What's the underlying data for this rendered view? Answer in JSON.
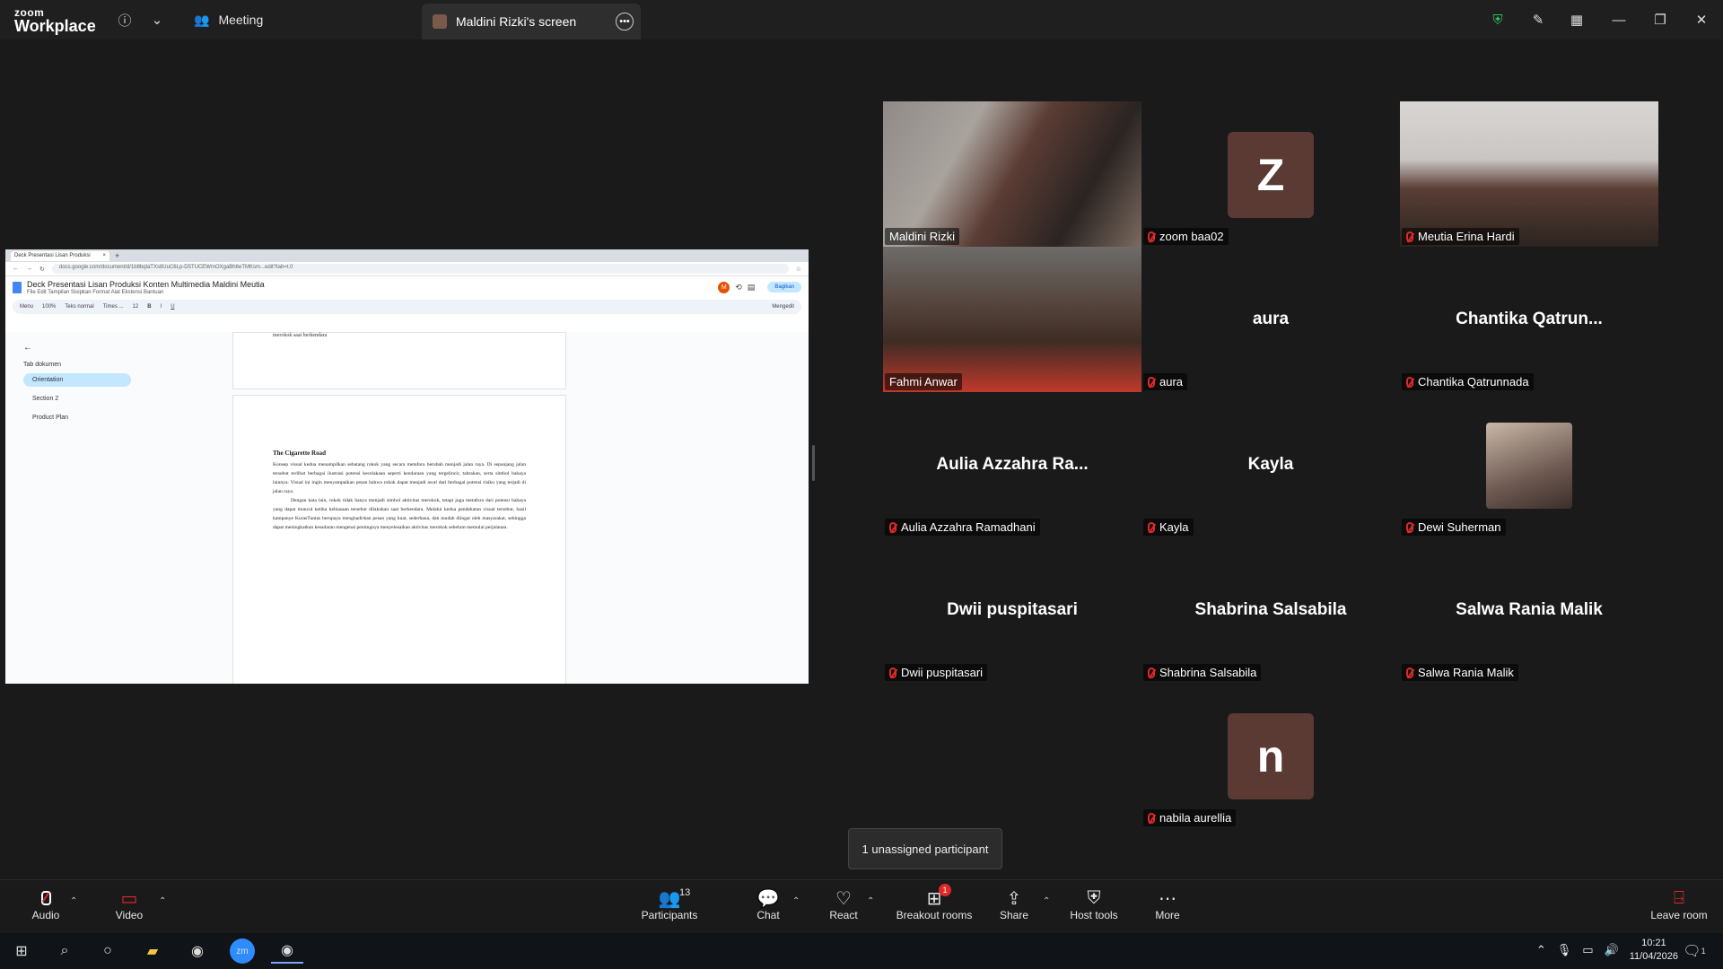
{
  "app": {
    "logo_line1": "zoom",
    "logo_line2": "Workplace",
    "meeting_label": "Meeting",
    "screen_tab_label": "Maldini Rizki's screen"
  },
  "shared_screen": {
    "browser_tab": "Deck Presentasi Lisan Produksi",
    "url": "docs.google.com/document/d/1b8bqlaTXs8UuC6Lp-D5TUCEWmOXgaBh6eTMKsm...edit?tab=t.0",
    "doc_title": "Deck Presentasi Lisan Produksi Konten Multimedia Maldini Meutia",
    "menu": "File  Edit  Tampilan  Sisipkan  Format  Alat  Ekstensi  Bantuan",
    "share_label": "Bagikan",
    "avatar_letter": "M",
    "toolbar_items": [
      "Menu",
      "100%",
      "Teks normal",
      "Times ...",
      "12",
      "B",
      "I",
      "U",
      "Mengedit"
    ],
    "side_header": "Tab dokumen",
    "tabs": [
      "Orientation",
      "Section 2",
      "Product Plan"
    ],
    "prev_page_tail": "merokok saat berkendara",
    "section_heading": "The Cigarette Road",
    "paragraph1": "Konsep visual kedua menampilkan sebatang rokok yang secara metafora berubah menjadi jalan raya. Di sepanjang jalan tersebut terlihat berbagai ilustrasi potensi kecelakaan seperti kendaraan yang tergelincir, tabrakan, serta simbol bahaya lainnya. Visual ini ingin menyampaikan pesan bahwa rokok dapat menjadi awal dari berbagai potensi risiko yang terjadi di jalan raya.",
    "paragraph2": "Dengan kata lain, rokok tidak hanya menjadi simbol aktivitas merokok, tetapi juga metafora dari potensi bahaya yang dapat muncul ketika kebiasaan tersebut dilakukan saat berkendara. Melalui kedua pendekatan visual tersebut, hasil kampanye KurasTuntas berupaya menghadirkan pesan yang kuat, sederhana, dan mudah diingat oleh masyarakat, sehingga dapat meningkatkan kesadaran mengenai pentingnya menyelesaikan aktivitas merokok sebelum memulai perjalanan."
  },
  "participants": [
    {
      "name": "Maldini Rizki",
      "type": "video",
      "muted": false
    },
    {
      "name": "zoom baa02",
      "type": "letter",
      "letter": "Z",
      "muted": true
    },
    {
      "name": "Meutia Erina Hardi",
      "type": "video",
      "muted": true
    },
    {
      "name": "Fahmi Anwar",
      "type": "video",
      "muted": false
    },
    {
      "name": "aura",
      "type": "text",
      "display": "aura",
      "muted": true
    },
    {
      "name": "Chantika Qatrunnada",
      "type": "text",
      "display": "Chantika  Qatrun...",
      "muted": true
    },
    {
      "name": "Aulia Azzahra Ramadhani",
      "type": "text",
      "display": "Aulia Azzahra Ra...",
      "muted": true
    },
    {
      "name": "Kayla",
      "type": "text",
      "display": "Kayla",
      "muted": true
    },
    {
      "name": "Dewi Suherman",
      "type": "photo",
      "muted": true
    },
    {
      "name": "Dwii puspitasari",
      "type": "text",
      "display": "Dwii puspitasari",
      "muted": true
    },
    {
      "name": "Shabrina Salsabila",
      "type": "text",
      "display": "Shabrina Salsabila",
      "muted": true
    },
    {
      "name": "Salwa Rania Malik",
      "type": "text",
      "display": "Salwa Rania Malik",
      "muted": true
    },
    {
      "name": "nabila aurellia",
      "type": "letter",
      "letter": "n",
      "muted": true
    }
  ],
  "tooltip": "1 unassigned participant",
  "toolbar": {
    "audio": "Audio",
    "video": "Video",
    "participants": "Participants",
    "participants_count": "13",
    "chat": "Chat",
    "react": "React",
    "breakout": "Breakout rooms",
    "breakout_badge": "1",
    "share": "Share",
    "host_tools": "Host tools",
    "more": "More",
    "leave": "Leave room"
  },
  "taskbar": {
    "time": "10:21",
    "date": "11/04/2026",
    "notif_count": "1"
  },
  "colors": {
    "active_speaker": "#31d8a0",
    "muted_red": "#e02828",
    "avatar_bg": "#5a3a33"
  }
}
